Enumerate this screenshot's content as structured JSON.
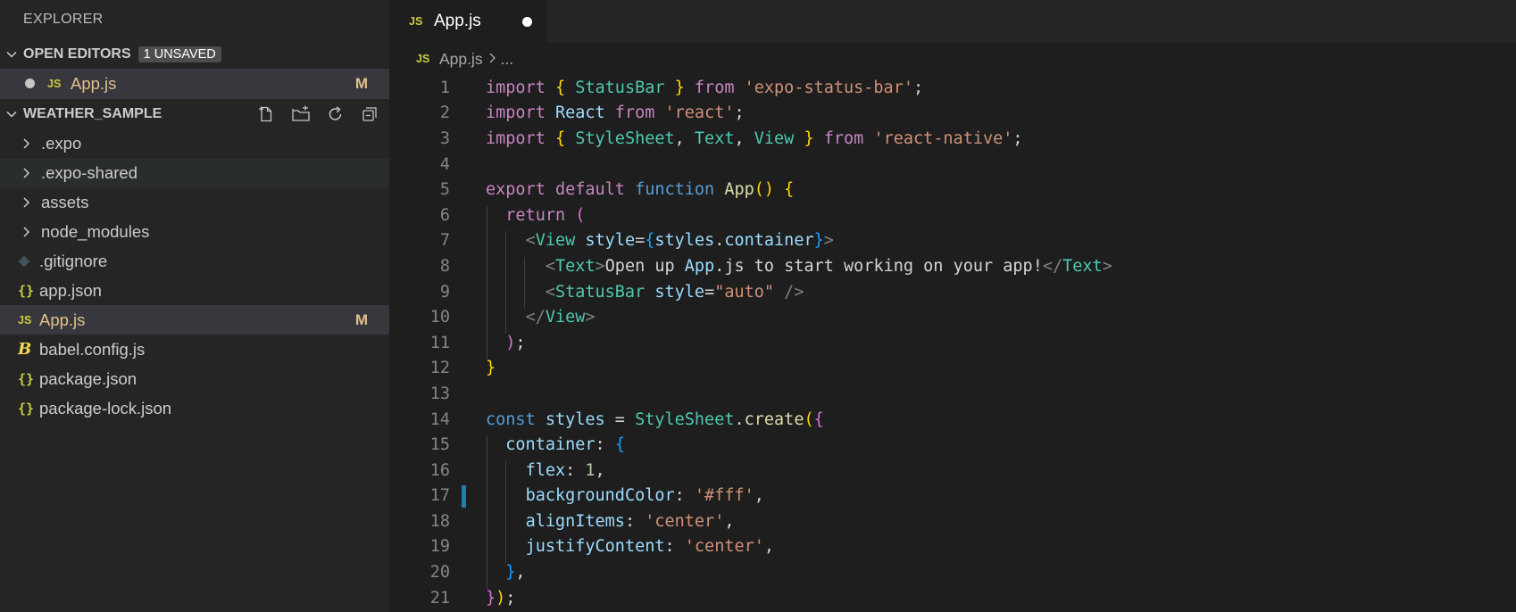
{
  "sidebar": {
    "title": "EXPLORER",
    "open_editors": {
      "label": "OPEN EDITORS",
      "badge": "1 UNSAVED",
      "items": [
        {
          "icon": "js-icon",
          "name": "App.js",
          "status": "M"
        }
      ]
    },
    "project": {
      "label": "WEATHER_SAMPLE",
      "actions": [
        "new-file-icon",
        "new-folder-icon",
        "refresh-icon",
        "collapse-all-icon"
      ],
      "items": [
        {
          "type": "folder",
          "name": ".expo"
        },
        {
          "type": "folder",
          "name": ".expo-shared"
        },
        {
          "type": "folder",
          "name": "assets"
        },
        {
          "type": "folder",
          "name": "node_modules"
        },
        {
          "type": "file",
          "icon": "git-icon",
          "name": ".gitignore"
        },
        {
          "type": "file",
          "icon": "json-icon",
          "name": "app.json"
        },
        {
          "type": "file",
          "icon": "js-icon",
          "name": "App.js",
          "status": "M"
        },
        {
          "type": "file",
          "icon": "babel-icon",
          "name": "babel.config.js"
        },
        {
          "type": "file",
          "icon": "json-icon",
          "name": "package.json"
        },
        {
          "type": "file",
          "icon": "json-icon",
          "name": "package-lock.json"
        }
      ]
    }
  },
  "editor": {
    "tab": {
      "icon_text": "JS",
      "title": "App.js"
    },
    "breadcrumb": {
      "file": "App.js",
      "rest": "..."
    },
    "icon_text": "JS",
    "code_lines": [
      "import { StatusBar } from 'expo-status-bar';",
      "import React from 'react';",
      "import { StyleSheet, Text, View } from 'react-native';",
      "",
      "export default function App() {",
      "  return (",
      "    <View style={styles.container}>",
      "      <Text>Open up App.js to start working on your app!</Text>",
      "      <StatusBar style=\"auto\" />",
      "    </View>",
      "  );",
      "}",
      "",
      "const styles = StyleSheet.create({",
      "  container: {",
      "    flex: 1,",
      "    backgroundColor: '#fff',",
      "    alignItems: 'center',",
      "    justifyContent: 'center',",
      "  },",
      "});"
    ],
    "modified_line": 17
  },
  "colors": {
    "keyword": "#c586c0",
    "storage": "#569cd6",
    "string": "#ce9178",
    "type": "#4ec9b0",
    "variable": "#9cdcfe",
    "function": "#dcdcaa",
    "number": "#b5cea8",
    "modified": "#e2c08d",
    "js_icon": "#cbcb41"
  }
}
